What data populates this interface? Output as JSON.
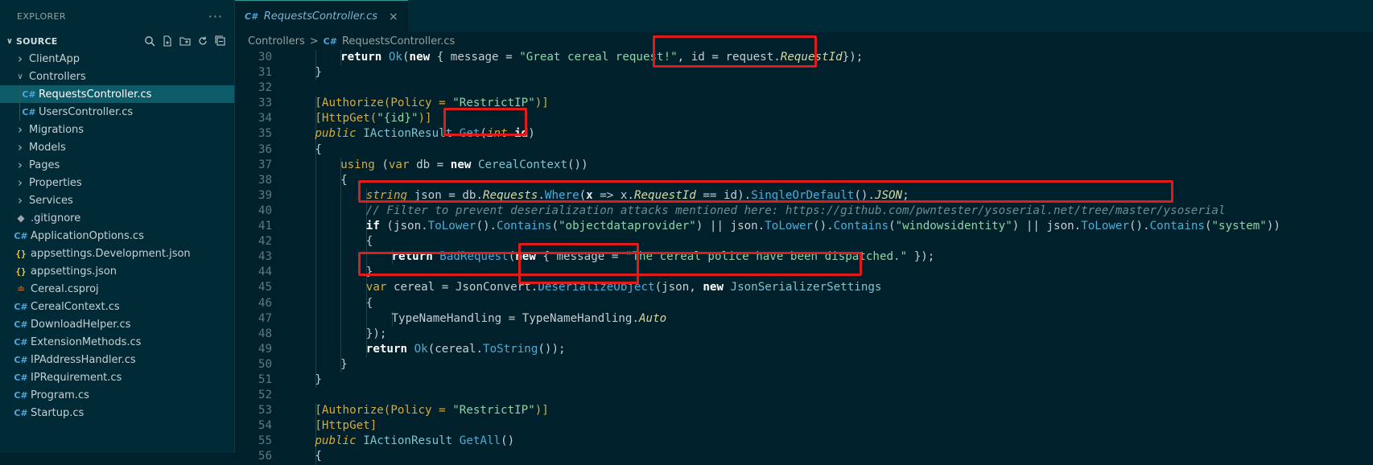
{
  "sidebar": {
    "title": "EXPLORER",
    "more": "···",
    "section": "SOURCE",
    "items": [
      {
        "label": "ClientApp",
        "kind": "folder",
        "indent": 1,
        "expanded": false
      },
      {
        "label": "Controllers",
        "kind": "folder",
        "indent": 1,
        "expanded": true
      },
      {
        "label": "RequestsController.cs",
        "kind": "cs",
        "indent": 2,
        "selected": true
      },
      {
        "label": "UsersController.cs",
        "kind": "cs",
        "indent": 2
      },
      {
        "label": "Migrations",
        "kind": "folder",
        "indent": 1,
        "expanded": false
      },
      {
        "label": "Models",
        "kind": "folder",
        "indent": 1,
        "expanded": false
      },
      {
        "label": "Pages",
        "kind": "folder",
        "indent": 1,
        "expanded": false
      },
      {
        "label": "Properties",
        "kind": "folder",
        "indent": 1,
        "expanded": false
      },
      {
        "label": "Services",
        "kind": "folder",
        "indent": 1,
        "expanded": false
      },
      {
        "label": ".gitignore",
        "kind": "git",
        "indent": 0
      },
      {
        "label": "ApplicationOptions.cs",
        "kind": "cs",
        "indent": 0
      },
      {
        "label": "appsettings.Development.json",
        "kind": "json",
        "indent": 0
      },
      {
        "label": "appsettings.json",
        "kind": "json",
        "indent": 0
      },
      {
        "label": "Cereal.csproj",
        "kind": "rss",
        "indent": 0
      },
      {
        "label": "CerealContext.cs",
        "kind": "cs",
        "indent": 0
      },
      {
        "label": "DownloadHelper.cs",
        "kind": "cs",
        "indent": 0
      },
      {
        "label": "ExtensionMethods.cs",
        "kind": "cs",
        "indent": 0
      },
      {
        "label": "IPAddressHandler.cs",
        "kind": "cs",
        "indent": 0
      },
      {
        "label": "IPRequirement.cs",
        "kind": "cs",
        "indent": 0
      },
      {
        "label": "Program.cs",
        "kind": "cs",
        "indent": 0
      },
      {
        "label": "Startup.cs",
        "kind": "cs",
        "indent": 0
      }
    ]
  },
  "editor": {
    "tab": {
      "icon": "C#",
      "label": "RequestsController.cs",
      "close": "×"
    },
    "breadcrumb": {
      "folder": "Controllers",
      "sep": ">",
      "file": "RequestsController.cs"
    },
    "lines": [
      {
        "n": "30",
        "depth": 3,
        "t": [
          [
            "k",
            "return "
          ],
          [
            "mth",
            "Ok"
          ],
          [
            "p",
            "("
          ],
          [
            "k",
            "new"
          ],
          [
            "p",
            " { message = "
          ],
          [
            "str",
            "\"Great cereal request!\""
          ],
          [
            "p",
            ", id = request."
          ],
          [
            "prop",
            "RequestId"
          ],
          [
            "p",
            "});"
          ]
        ]
      },
      {
        "n": "31",
        "depth": 2,
        "t": [
          [
            "p",
            "}"
          ]
        ]
      },
      {
        "n": "32",
        "depth": 0,
        "t": []
      },
      {
        "n": "33",
        "depth": 2,
        "t": [
          [
            "attr",
            "[Authorize(Policy = "
          ],
          [
            "str",
            "\"RestrictIP\""
          ],
          [
            "attr",
            ")]"
          ]
        ]
      },
      {
        "n": "34",
        "depth": 2,
        "t": [
          [
            "attr",
            "[HttpGet("
          ],
          [
            "str",
            "\"{id}\""
          ],
          [
            "attr",
            ")]"
          ]
        ]
      },
      {
        "n": "35",
        "depth": 2,
        "t": [
          [
            "pub",
            "public "
          ],
          [
            "typ",
            "IActionResult "
          ],
          [
            "mth",
            "Get"
          ],
          [
            "p",
            "("
          ],
          [
            "pub",
            "int "
          ],
          [
            "bold",
            "id"
          ],
          [
            "p",
            ")"
          ]
        ]
      },
      {
        "n": "36",
        "depth": 2,
        "t": [
          [
            "p",
            "{"
          ]
        ]
      },
      {
        "n": "37",
        "depth": 3,
        "t": [
          [
            "kwo",
            "using "
          ],
          [
            "p",
            "("
          ],
          [
            "kwo",
            "var "
          ],
          [
            "p",
            "db = "
          ],
          [
            "k",
            "new "
          ],
          [
            "typ",
            "CerealContext"
          ],
          [
            "p",
            "())"
          ]
        ]
      },
      {
        "n": "38",
        "depth": 3,
        "t": [
          [
            "p",
            "{"
          ]
        ]
      },
      {
        "n": "39",
        "depth": 4,
        "t": [
          [
            "pub",
            "string "
          ],
          [
            "p",
            "json = db."
          ],
          [
            "prop",
            "Requests"
          ],
          [
            "p",
            "."
          ],
          [
            "mth",
            "Where"
          ],
          [
            "p",
            "("
          ],
          [
            "bold",
            "x"
          ],
          [
            "p",
            " => x."
          ],
          [
            "prop",
            "RequestId"
          ],
          [
            "p",
            " == id)."
          ],
          [
            "mth",
            "SingleOrDefault"
          ],
          [
            "p",
            "()."
          ],
          [
            "prop",
            "JSON"
          ],
          [
            "p",
            ";"
          ]
        ]
      },
      {
        "n": "40",
        "depth": 4,
        "t": [
          [
            "cmt",
            "// Filter to prevent deserialization attacks mentioned here: https://github.com/pwntester/ysoserial.net/tree/master/ysoserial"
          ]
        ]
      },
      {
        "n": "41",
        "depth": 4,
        "t": [
          [
            "k",
            "if "
          ],
          [
            "p",
            "(json."
          ],
          [
            "mth",
            "ToLower"
          ],
          [
            "p",
            "()."
          ],
          [
            "mth",
            "Contains"
          ],
          [
            "p",
            "("
          ],
          [
            "str",
            "\"objectdataprovider\""
          ],
          [
            "p",
            ") || json."
          ],
          [
            "mth",
            "ToLower"
          ],
          [
            "p",
            "()."
          ],
          [
            "mth",
            "Contains"
          ],
          [
            "p",
            "("
          ],
          [
            "str",
            "\"windowsidentity\""
          ],
          [
            "p",
            ") || json."
          ],
          [
            "mth",
            "ToLower"
          ],
          [
            "p",
            "()."
          ],
          [
            "mth",
            "Contains"
          ],
          [
            "p",
            "("
          ],
          [
            "str",
            "\"system\""
          ],
          [
            "p",
            "))"
          ]
        ]
      },
      {
        "n": "42",
        "depth": 4,
        "t": [
          [
            "p",
            "{"
          ]
        ]
      },
      {
        "n": "43",
        "depth": 5,
        "t": [
          [
            "k",
            "return "
          ],
          [
            "mth",
            "BadRequest"
          ],
          [
            "p",
            "("
          ],
          [
            "k",
            "new"
          ],
          [
            "p",
            " { message = "
          ],
          [
            "str",
            "\"The cereal police have been dispatched.\""
          ],
          [
            "p",
            " });"
          ]
        ]
      },
      {
        "n": "44",
        "depth": 4,
        "t": [
          [
            "p",
            "}"
          ]
        ]
      },
      {
        "n": "45",
        "depth": 4,
        "t": [
          [
            "kwo",
            "var "
          ],
          [
            "p",
            "cereal = JsonConvert."
          ],
          [
            "mth",
            "DeserializeObject"
          ],
          [
            "p",
            "(json, "
          ],
          [
            "k",
            "new "
          ],
          [
            "typ",
            "JsonSerializerSettings"
          ]
        ]
      },
      {
        "n": "46",
        "depth": 4,
        "t": [
          [
            "p",
            "{"
          ]
        ]
      },
      {
        "n": "47",
        "depth": 5,
        "t": [
          [
            "p",
            "TypeNameHandling = TypeNameHandling."
          ],
          [
            "prop",
            "Auto"
          ]
        ]
      },
      {
        "n": "48",
        "depth": 4,
        "t": [
          [
            "p",
            "});"
          ]
        ]
      },
      {
        "n": "49",
        "depth": 4,
        "t": [
          [
            "k",
            "return "
          ],
          [
            "mth",
            "Ok"
          ],
          [
            "p",
            "(cereal."
          ],
          [
            "mth",
            "ToString"
          ],
          [
            "p",
            "());"
          ]
        ]
      },
      {
        "n": "50",
        "depth": 3,
        "t": [
          [
            "p",
            "}"
          ]
        ]
      },
      {
        "n": "51",
        "depth": 2,
        "t": [
          [
            "p",
            "}"
          ]
        ]
      },
      {
        "n": "52",
        "depth": 0,
        "t": []
      },
      {
        "n": "53",
        "depth": 2,
        "t": [
          [
            "attr",
            "[Authorize(Policy = "
          ],
          [
            "str",
            "\"RestrictIP\""
          ],
          [
            "attr",
            ")]"
          ]
        ]
      },
      {
        "n": "54",
        "depth": 2,
        "t": [
          [
            "attr",
            "[HttpGet]"
          ]
        ]
      },
      {
        "n": "55",
        "depth": 2,
        "t": [
          [
            "pub",
            "public "
          ],
          [
            "typ",
            "IActionResult "
          ],
          [
            "mth",
            "GetAll"
          ],
          [
            "p",
            "()"
          ]
        ]
      },
      {
        "n": "56",
        "depth": 2,
        "t": [
          [
            "p",
            "{"
          ]
        ]
      }
    ]
  },
  "annotations": [
    "id = request.RequestId",
    "Get(int id)",
    "// Filter to prevent deserialization attacks ...",
    "DeserializeObject",
    "var cereal = JsonConvert.DeserializeObject(json, new JsonSerializerSettings"
  ],
  "colors": {
    "highlight": "#e01b1b",
    "selection": "#0d5a69",
    "background": "#00212b"
  }
}
